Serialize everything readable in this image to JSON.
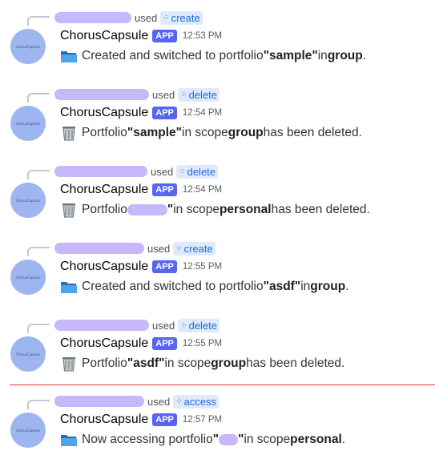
{
  "app_name": "ChorusCapsule",
  "app_tag": "APP",
  "avatar_label": "ChorusCapsule",
  "reply_used": "used",
  "messages": [
    {
      "command": "create",
      "time": "12:53 PM",
      "icon": "folder-icon",
      "parts": [
        "Created and switched to portfolio ",
        "\"sample\"",
        " in ",
        "group",
        "."
      ]
    },
    {
      "command": "delete",
      "time": "12:54 PM",
      "icon": "wastebasket-icon",
      "parts": [
        "Portfolio ",
        "\"sample\"",
        " in scope ",
        "group",
        " has been deleted."
      ]
    },
    {
      "command": "delete",
      "time": "12:54 PM",
      "icon": "wastebasket-icon",
      "parts": [
        "Portfolio ",
        "\"",
        " in scope ",
        "personal",
        " has been deleted."
      ]
    },
    {
      "command": "create",
      "time": "12:55 PM",
      "icon": "folder-icon",
      "parts": [
        "Created and switched to portfolio ",
        "\"asdf\"",
        " in ",
        "group",
        "."
      ]
    },
    {
      "command": "delete",
      "time": "12:55 PM",
      "icon": "wastebasket-icon",
      "parts": [
        "Portfolio ",
        "\"asdf\"",
        " in scope ",
        "group",
        " has been deleted."
      ]
    },
    {
      "command": "access",
      "time": "12:57 PM",
      "icon": "folder-icon",
      "parts": [
        "Now accessing portfolio ",
        "\"",
        "\"",
        " in scope ",
        "personal",
        "."
      ]
    }
  ],
  "colors": {
    "app_tag": "#5865f2",
    "command_pill_bg": "#e0e9fd",
    "command_pill_text": "#1e6fd6",
    "new_messages_divider": "#d83c3e",
    "redaction": "#c7b8fb"
  }
}
